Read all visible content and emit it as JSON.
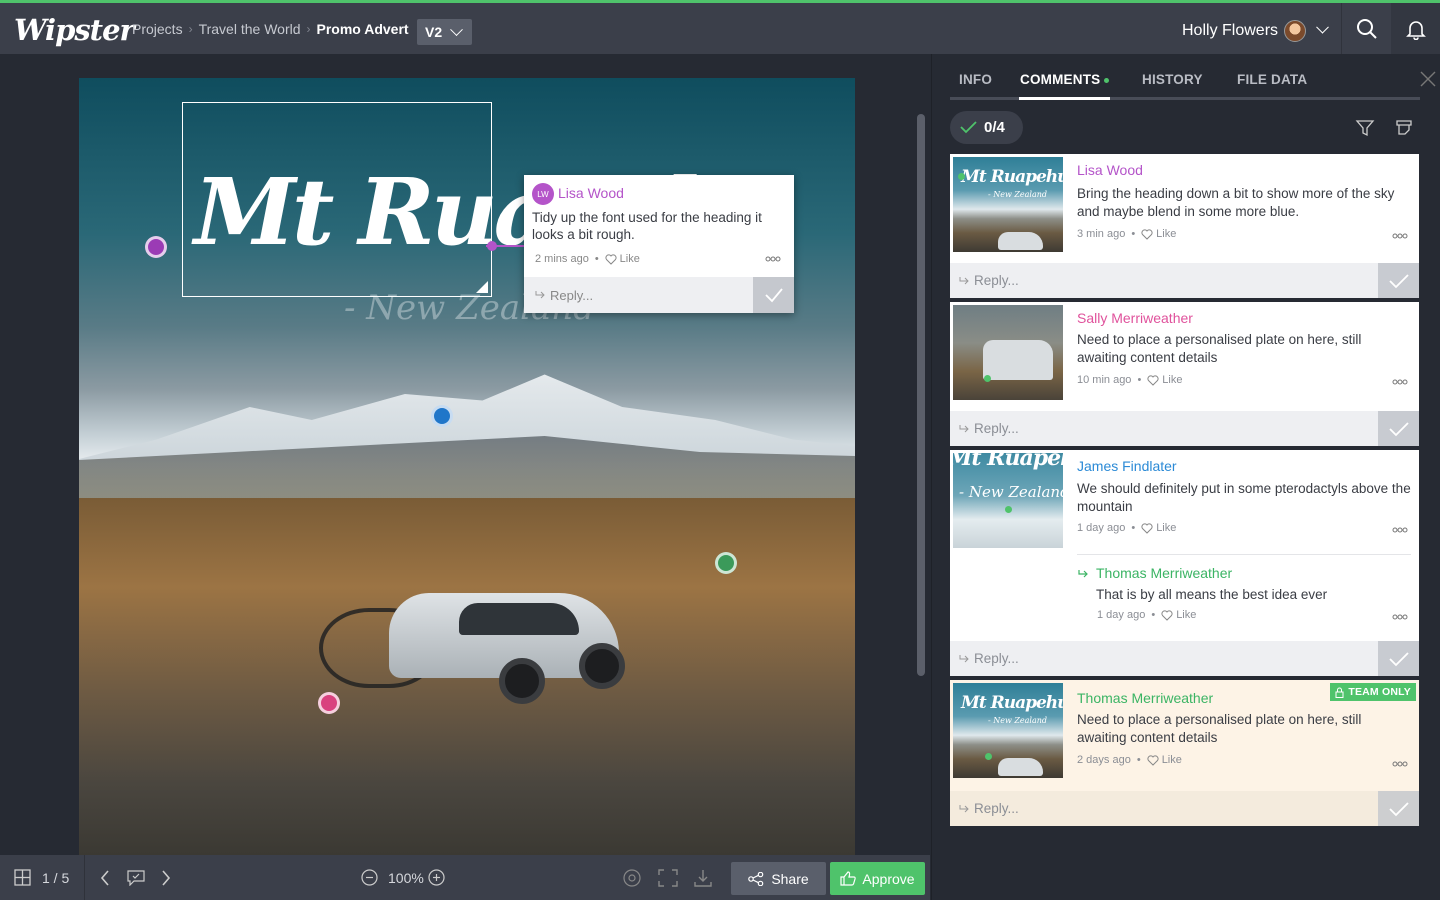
{
  "app": {
    "logo": "Wipster"
  },
  "breadcrumb": {
    "items": [
      "Projects",
      "Travel the World"
    ],
    "current": "Promo Advert"
  },
  "version": {
    "label": "V2"
  },
  "user": {
    "name": "Holly Flowers"
  },
  "viewer": {
    "image_title": "Mt Ruapehu",
    "image_subtitle": "- New Zealand",
    "popup": {
      "initials": "LW",
      "author": "Lisa Wood",
      "text": "Tidy up the font used for the heading it looks a bit rough.",
      "time": "2 mins ago",
      "like": "Like",
      "reply": "Reply..."
    }
  },
  "pins": [
    {
      "color": "#9b3bb5"
    },
    {
      "color": "#2076c9"
    },
    {
      "color": "#3b9a5a"
    },
    {
      "color": "#d9417e"
    }
  ],
  "bottombar": {
    "page_counter": "1 / 5",
    "zoom": "100%",
    "share_label": "Share",
    "approve_label": "Approve"
  },
  "panel": {
    "tabs": [
      {
        "label": "INFO"
      },
      {
        "label": "COMMENTS"
      },
      {
        "label": "HISTORY"
      },
      {
        "label": "FILE DATA"
      }
    ],
    "resolved_count": "0/4",
    "comments": [
      {
        "author": "Lisa Wood",
        "author_color": "#b454c9",
        "text": "Bring the heading down a bit to show more of the sky and maybe blend in some more blue.",
        "time": "3 min ago",
        "like": "Like",
        "reply": "Reply..."
      },
      {
        "author": "Sally Merriweather",
        "author_color": "#e0529c",
        "text": "Need to place a personalised plate on here, still awaiting content details",
        "time": "10 min ago",
        "like": "Like",
        "reply": "Reply..."
      },
      {
        "author": "James Findlater",
        "author_color": "#2b8ad6",
        "text": "We should definitely put in some pterodactyls above the mountain",
        "time": "1 day ago",
        "like": "Like",
        "reply": "Reply...",
        "thread_reply": {
          "author": "Thomas Merriweather",
          "author_color": "#3bb464",
          "text": "That is by all means the best idea ever",
          "time": "1 day ago",
          "like": "Like"
        }
      },
      {
        "author": "Thomas Merriweather",
        "author_color": "#3bb464",
        "badge": "TEAM ONLY",
        "text": "Need to place a personalised plate on here, still awaiting content details",
        "time": "2 days ago",
        "like": "Like",
        "reply": "Reply..."
      }
    ]
  }
}
